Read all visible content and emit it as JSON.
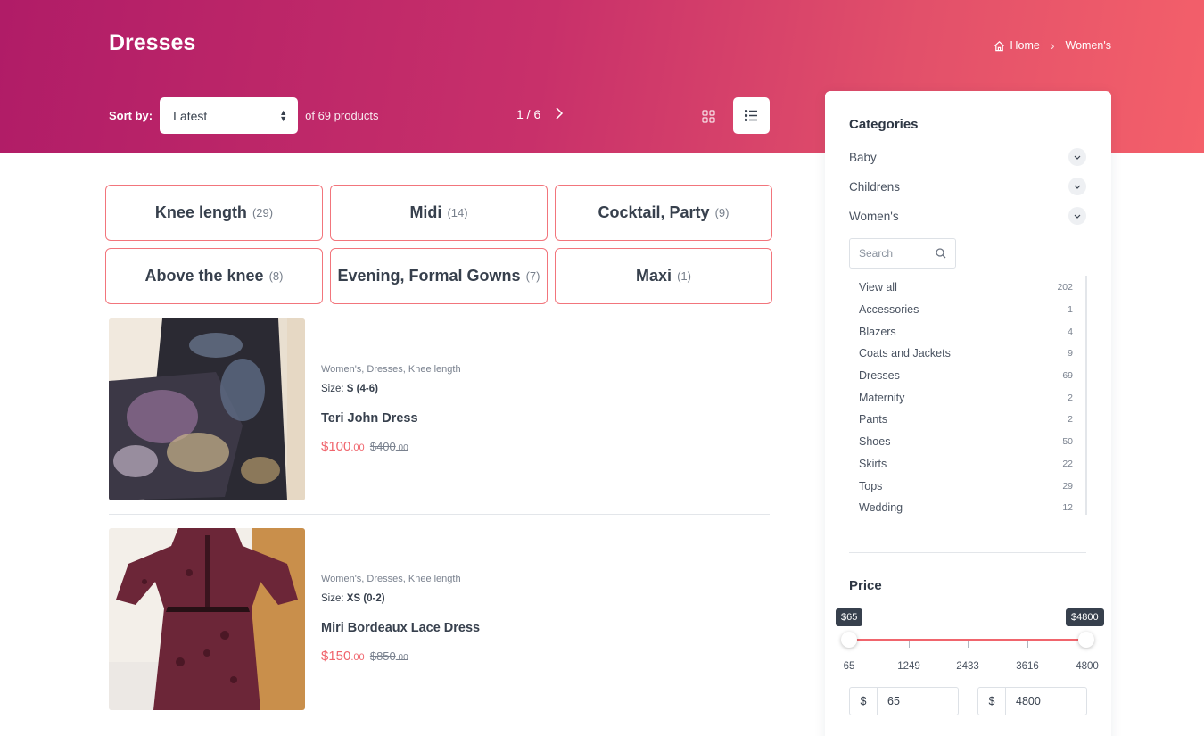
{
  "header": {
    "title": "Dresses",
    "breadcrumb": {
      "home": "Home",
      "current": "Women's"
    },
    "sort_label": "Sort by:",
    "sort_value": "Latest",
    "product_count": "of 69 products",
    "pagination": "1 / 6"
  },
  "categories": [
    {
      "label": "Knee length",
      "count": "(29)"
    },
    {
      "label": "Midi",
      "count": "(14)"
    },
    {
      "label": "Cocktail, Party",
      "count": "(9)"
    },
    {
      "label": "Above the knee",
      "count": "(8)"
    },
    {
      "label": "Evening, Formal Gowns",
      "count": "(7)"
    },
    {
      "label": "Maxi",
      "count": "(1)"
    }
  ],
  "products": [
    {
      "categories": "Women's, Dresses, Knee length",
      "size_label": "Size:",
      "size": "S (4-6)",
      "name": "Teri John Dress",
      "price_main": "$100",
      "price_cents": ".00",
      "old_main": "$400",
      "old_cents": ".00"
    },
    {
      "categories": "Women's, Dresses, Knee length",
      "size_label": "Size:",
      "size": "XS (0-2)",
      "name": "Miri Bordeaux Lace Dress",
      "price_main": "$150",
      "price_cents": ".00",
      "old_main": "$850",
      "old_cents": ".00"
    }
  ],
  "sidebar": {
    "categories_title": "Categories",
    "top_categories": [
      "Baby",
      "Childrens",
      "Women's"
    ],
    "search_placeholder": "Search",
    "subcategories": [
      {
        "label": "View all",
        "count": "202"
      },
      {
        "label": "Accessories",
        "count": "1"
      },
      {
        "label": "Blazers",
        "count": "4"
      },
      {
        "label": "Coats and Jackets",
        "count": "9"
      },
      {
        "label": "Dresses",
        "count": "69"
      },
      {
        "label": "Maternity",
        "count": "2"
      },
      {
        "label": "Pants",
        "count": "2"
      },
      {
        "label": "Shoes",
        "count": "50"
      },
      {
        "label": "Skirts",
        "count": "22"
      },
      {
        "label": "Tops",
        "count": "29"
      },
      {
        "label": "Wedding",
        "count": "12"
      }
    ],
    "price_title": "Price",
    "price_min_tip": "$65",
    "price_max_tip": "$4800",
    "ticks": [
      "65",
      "1249",
      "2433",
      "3616",
      "4800"
    ],
    "currency": "$",
    "min_value": "65",
    "max_value": "4800"
  },
  "colors": {
    "accent": "#f0656d",
    "hero_start": "#b01c67",
    "hero_end": "#f4606a",
    "text": "#37404d"
  },
  "icons": {
    "home": "home-icon",
    "next": "chevron-right-icon",
    "grid": "grid-view-icon",
    "list": "list-view-icon",
    "search": "search-icon",
    "chevron": "chevron-down-icon"
  }
}
